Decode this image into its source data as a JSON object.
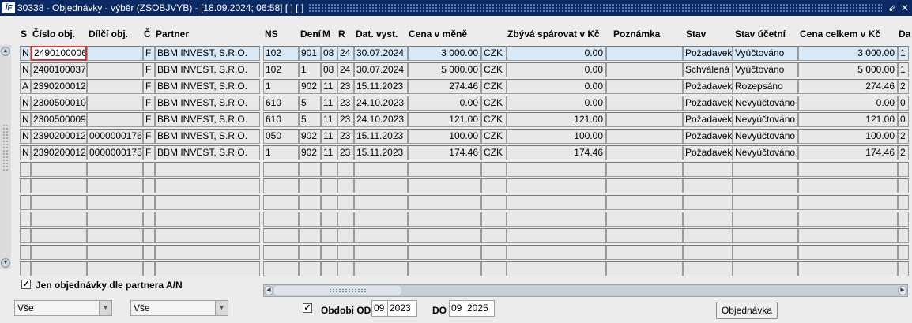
{
  "window": {
    "title": "30338 - Objednávky - výběr (ZSOBJVYB) - [18.09.2024; 06:58]  [ ]  [ ]"
  },
  "columns": [
    "S",
    "Číslo obj.",
    "Dílčí obj.",
    "Č",
    "Partner",
    "NS",
    "Dení",
    "M",
    "R",
    "Dat. vyst.",
    "Cena v měně",
    "Zbývá spárovat v Kč",
    "Poznámka",
    "Stav",
    "Stav účetní",
    "Cena celkem v Kč",
    "Da"
  ],
  "rows": [
    [
      "N",
      "2490100006",
      "",
      "F",
      "BBM INVEST, S.R.O.",
      "102",
      "901",
      "08",
      "24",
      "30.07.2024",
      "3 000.00",
      "CZK",
      "0.00",
      "",
      "Požadavek",
      "Vyúčtováno",
      "3 000.00",
      "1"
    ],
    [
      "N",
      "2400100037",
      "",
      "F",
      "BBM INVEST, S.R.O.",
      "102",
      "1",
      "08",
      "24",
      "30.07.2024",
      "5 000.00",
      "CZK",
      "0.00",
      "",
      "Schválená",
      "Vyúčtováno",
      "5 000.00",
      "1"
    ],
    [
      "A",
      "2390200012",
      "",
      "F",
      "BBM INVEST, S.R.O.",
      "1",
      "902",
      "11",
      "23",
      "15.11.2023",
      "274.46",
      "CZK",
      "0.00",
      "",
      "Požadavek",
      "Rozepsáno",
      "274.46",
      "2"
    ],
    [
      "N",
      "2300500010",
      "",
      "F",
      "BBM INVEST, S.R.O.",
      "610",
      "5",
      "11",
      "23",
      "24.10.2023",
      "0.00",
      "CZK",
      "0.00",
      "",
      "Požadavek",
      "Nevyúčtováno",
      "0.00",
      "0"
    ],
    [
      "N",
      "2300500009",
      "",
      "F",
      "BBM INVEST, S.R.O.",
      "610",
      "5",
      "11",
      "23",
      "24.10.2023",
      "121.00",
      "CZK",
      "121.00",
      "",
      "Požadavek",
      "Nevyúčtováno",
      "121.00",
      "0"
    ],
    [
      "N",
      "2390200012",
      "0000000176",
      "F",
      "BBM INVEST, S.R.O.",
      "050",
      "902",
      "11",
      "23",
      "15.11.2023",
      "100.00",
      "CZK",
      "100.00",
      "",
      "Požadavek",
      "Nevyúčtováno",
      "100.00",
      "2"
    ],
    [
      "N",
      "2390200012",
      "0000000175",
      "F",
      "BBM INVEST, S.R.O.",
      "1",
      "902",
      "11",
      "23",
      "15.11.2023",
      "174.46",
      "CZK",
      "174.46",
      "",
      "Požadavek",
      "Nevyúčtováno",
      "174.46",
      "2"
    ]
  ],
  "empty_row_count": 7,
  "filters": {
    "partner_only_label": "Jen objednávky dle partnera A/N",
    "partner_only_checked": true,
    "select1_value": "Vše",
    "select2_value": "Vše",
    "period_checked": true,
    "period_from_label": "Obdobi OD",
    "period_from_month": "09",
    "period_from_year": "2023",
    "period_to_label": "DO",
    "period_to_month": "09",
    "period_to_year": "2025"
  },
  "buttons": {
    "order_label": "Objednávka"
  },
  "icons": {
    "app": "app-logo-icon",
    "minimize": "minimize-icon",
    "close": "close-icon"
  }
}
